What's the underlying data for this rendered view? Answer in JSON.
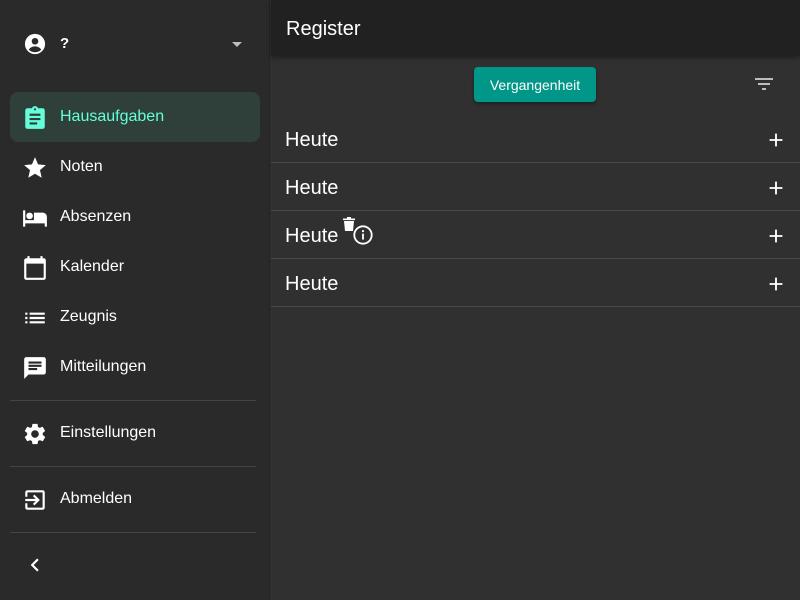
{
  "account": {
    "name": "?",
    "icon": "account-circle-icon"
  },
  "nav": {
    "items": [
      {
        "label": "Hausaufgaben",
        "icon": "assignment-icon",
        "active": true
      },
      {
        "label": "Noten",
        "icon": "star-icon"
      },
      {
        "label": "Absenzen",
        "icon": "bed-icon"
      },
      {
        "label": "Kalender",
        "icon": "calendar-icon"
      },
      {
        "label": "Zeugnis",
        "icon": "list-icon"
      },
      {
        "label": "Mitteilungen",
        "icon": "message-icon"
      }
    ],
    "settings": {
      "label": "Einstellungen",
      "icon": "gear-icon"
    },
    "logout": {
      "label": "Abmelden",
      "icon": "logout-icon"
    }
  },
  "header": {
    "title": "Register"
  },
  "toolbar": {
    "past_label": "Vergangenheit"
  },
  "rows": [
    {
      "label": "Heute"
    },
    {
      "label": "Heute"
    },
    {
      "label": "Heute"
    },
    {
      "label": "Heute"
    }
  ],
  "colors": {
    "accent": "#64ffda",
    "button": "#009688",
    "active_bg": "#2f3f39"
  }
}
